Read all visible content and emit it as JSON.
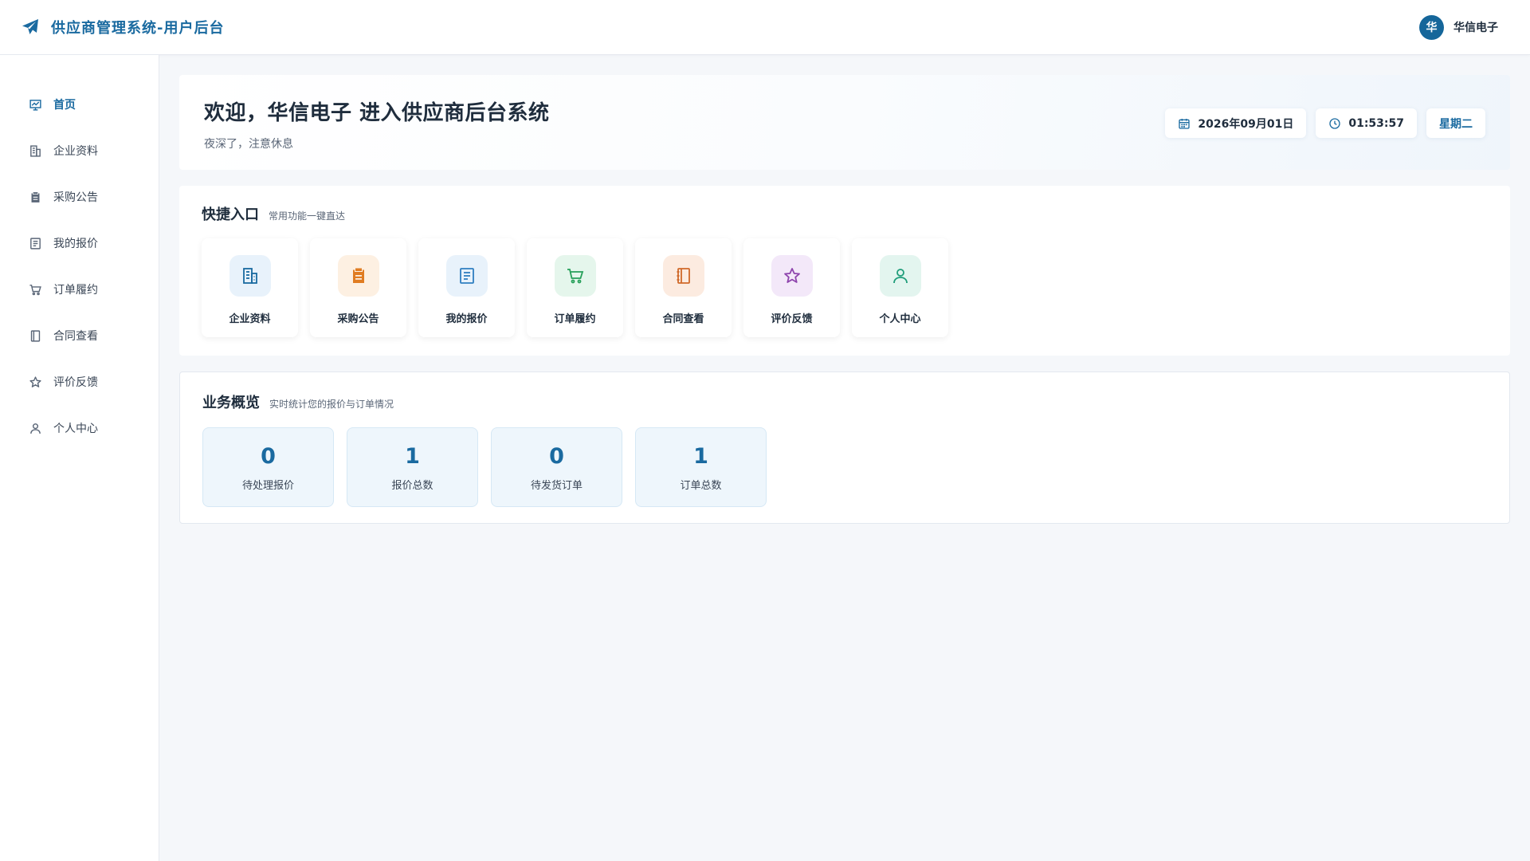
{
  "header": {
    "title": "供应商管理系统-用户后台",
    "brand_icon": "paper-plane-icon",
    "user": {
      "avatar_text": "华",
      "name": "华信电子"
    }
  },
  "sidebar": {
    "items": [
      {
        "label": "首页",
        "icon": "chart-board-icon",
        "active": true
      },
      {
        "label": "企业资料",
        "icon": "building-icon"
      },
      {
        "label": "采购公告",
        "icon": "clipboard-icon"
      },
      {
        "label": "我的报价",
        "icon": "document-icon"
      },
      {
        "label": "订单履约",
        "icon": "cart-icon"
      },
      {
        "label": "合同查看",
        "icon": "notebook-icon"
      },
      {
        "label": "评价反馈",
        "icon": "star-icon"
      },
      {
        "label": "个人中心",
        "icon": "user-icon"
      }
    ]
  },
  "welcome": {
    "title": "欢迎，华信电子 进入供应商后台系统",
    "subtitle": "夜深了，注意休息",
    "date": "2026年09月01日",
    "time": "01:53:57",
    "weekday": "星期二"
  },
  "quick": {
    "title": "快捷入口",
    "subtitle": "常用功能一键直达",
    "items": [
      {
        "label": "企业资料",
        "icon": "building-icon",
        "color": "#1a6aa0",
        "bg": "#e8f2fb"
      },
      {
        "label": "采购公告",
        "icon": "clipboard-icon",
        "color": "#e07c22",
        "bg": "#fdf0e2"
      },
      {
        "label": "我的报价",
        "icon": "document-icon",
        "color": "#2f7fc1",
        "bg": "#e8f2fb"
      },
      {
        "label": "订单履约",
        "icon": "cart-icon",
        "color": "#27a05a",
        "bg": "#e5f6ec"
      },
      {
        "label": "合同查看",
        "icon": "notebook-icon",
        "color": "#d0692a",
        "bg": "#fcebe0"
      },
      {
        "label": "评价反馈",
        "icon": "star-icon",
        "color": "#8e44ad",
        "bg": "#f3e8f9"
      },
      {
        "label": "个人中心",
        "icon": "user-icon",
        "color": "#1f9d7a",
        "bg": "#e3f5ef"
      }
    ]
  },
  "stats": {
    "title": "业务概览",
    "subtitle": "实时统计您的报价与订单情况",
    "items": [
      {
        "value": "0",
        "label": "待处理报价"
      },
      {
        "value": "1",
        "label": "报价总数"
      },
      {
        "value": "0",
        "label": "待发货订单"
      },
      {
        "value": "1",
        "label": "订单总数"
      }
    ]
  },
  "colors": {
    "accent": "#1a6aa0",
    "page_bg": "#f5f7fa"
  }
}
